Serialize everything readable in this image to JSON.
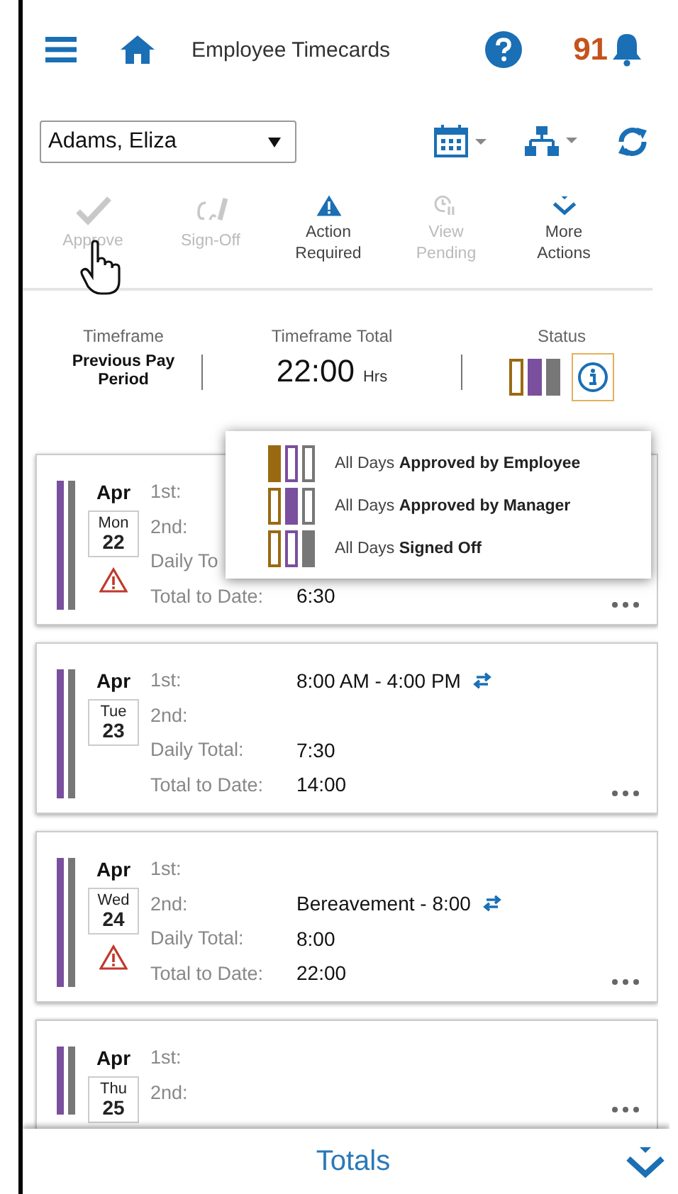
{
  "header": {
    "title": "Employee Timecards",
    "notification_count": "91"
  },
  "employee_select": {
    "value": "Adams, Eliza"
  },
  "actions": [
    {
      "kind": "check",
      "label": "Approve",
      "disabled": true
    },
    {
      "kind": "sign",
      "label": "Sign-Off",
      "disabled": true
    },
    {
      "kind": "warning",
      "label": "Action Required",
      "disabled": false
    },
    {
      "kind": "pending",
      "label": "View Pending",
      "disabled": true
    },
    {
      "kind": "more",
      "label": "More Actions",
      "disabled": false
    }
  ],
  "summary": {
    "timeframe_label": "Timeframe",
    "timeframe_value": "Previous Pay Period",
    "total_label": "Timeframe Total",
    "total_value": "22:00",
    "total_unit": "Hrs",
    "status_label": "Status",
    "status_bars": [
      {
        "color": "#9a6a12",
        "filled": false
      },
      {
        "color": "#7a4f9e",
        "filled": true
      },
      {
        "color": "#777777",
        "filled": true
      }
    ]
  },
  "status_legend": [
    {
      "text": "All Days **Approved by Employee**",
      "bars": [
        {
          "color": "#9a6a12",
          "filled": true
        },
        {
          "color": "#7a4f9e",
          "filled": false
        },
        {
          "color": "#777777",
          "filled": false
        }
      ]
    },
    {
      "text": "All Days **Approved by Manager**",
      "bars": [
        {
          "color": "#9a6a12",
          "filled": false
        },
        {
          "color": "#7a4f9e",
          "filled": true
        },
        {
          "color": "#777777",
          "filled": false
        }
      ]
    },
    {
      "text": "All Days **Signed Off**",
      "bars": [
        {
          "color": "#9a6a12",
          "filled": false
        },
        {
          "color": "#7a4f9e",
          "filled": false
        },
        {
          "color": "#777777",
          "filled": true
        }
      ]
    }
  ],
  "days": [
    {
      "month": "Apr",
      "weekday": "Mon",
      "date": "22",
      "warning": true,
      "bars": [
        {
          "color": "#7a4f9e"
        },
        {
          "color": "#777777"
        }
      ],
      "rows": [
        {
          "label": "1st:"
        },
        {
          "label": "2nd:"
        },
        {
          "label": "Daily To"
        },
        {
          "label": "Total to Date:",
          "value": "6:30"
        }
      ]
    },
    {
      "month": "Apr",
      "weekday": "Tue",
      "date": "23",
      "warning": false,
      "bars": [
        {
          "color": "#7a4f9e"
        },
        {
          "color": "#777777"
        }
      ],
      "rows": [
        {
          "label": "1st:",
          "value": "8:00 AM - 4:00 PM",
          "swap": true
        },
        {
          "label": "2nd:"
        },
        {
          "label": "Daily Total:",
          "value": "7:30"
        },
        {
          "label": "Total to Date:",
          "value": "14:00"
        }
      ]
    },
    {
      "month": "Apr",
      "weekday": "Wed",
      "date": "24",
      "warning": true,
      "bars": [
        {
          "color": "#7a4f9e"
        },
        {
          "color": "#777777"
        }
      ],
      "rows": [
        {
          "label": "1st:"
        },
        {
          "label": "2nd:",
          "value": "Bereavement - 8:00",
          "swap": true
        },
        {
          "label": "Daily Total:",
          "value": "8:00"
        },
        {
          "label": "Total to Date:",
          "value": "22:00"
        }
      ]
    },
    {
      "month": "Apr",
      "weekday": "Thu",
      "date": "25",
      "warning": false,
      "bars": [
        {
          "color": "#7a4f9e"
        },
        {
          "color": "#777777"
        }
      ],
      "rows": [
        {
          "label": "1st:"
        },
        {
          "label": "2nd:"
        }
      ]
    }
  ],
  "footer": {
    "label": "Totals"
  }
}
